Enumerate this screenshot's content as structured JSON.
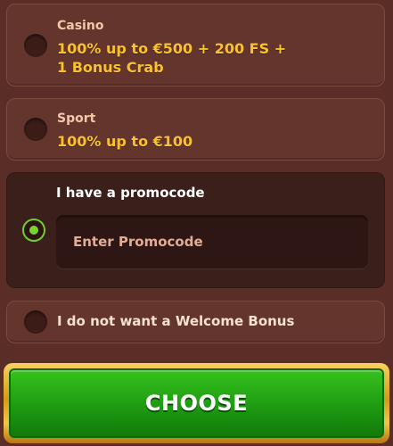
{
  "options": {
    "casino": {
      "category": "Casino",
      "offer_line1": "100% up to €500 + 200 FS +",
      "offer_line2": "1 Bonus Crab",
      "selected": false
    },
    "sport": {
      "category": "Sport",
      "offer_line1": "100% up to €100",
      "selected": false
    },
    "promocode": {
      "label": "I have a promocode",
      "placeholder": "Enter Promocode",
      "value": "",
      "selected": true
    },
    "no_bonus": {
      "label": "I do not want a Welcome Bonus",
      "selected": false
    }
  },
  "actions": {
    "choose_label": "CHOOSE"
  },
  "colors": {
    "background": "#5a2e27",
    "offer_text": "#f9c12e",
    "selected_radio": "#7bd42e",
    "button_green": "#1e9b12",
    "button_gold": "#d79a1b"
  }
}
